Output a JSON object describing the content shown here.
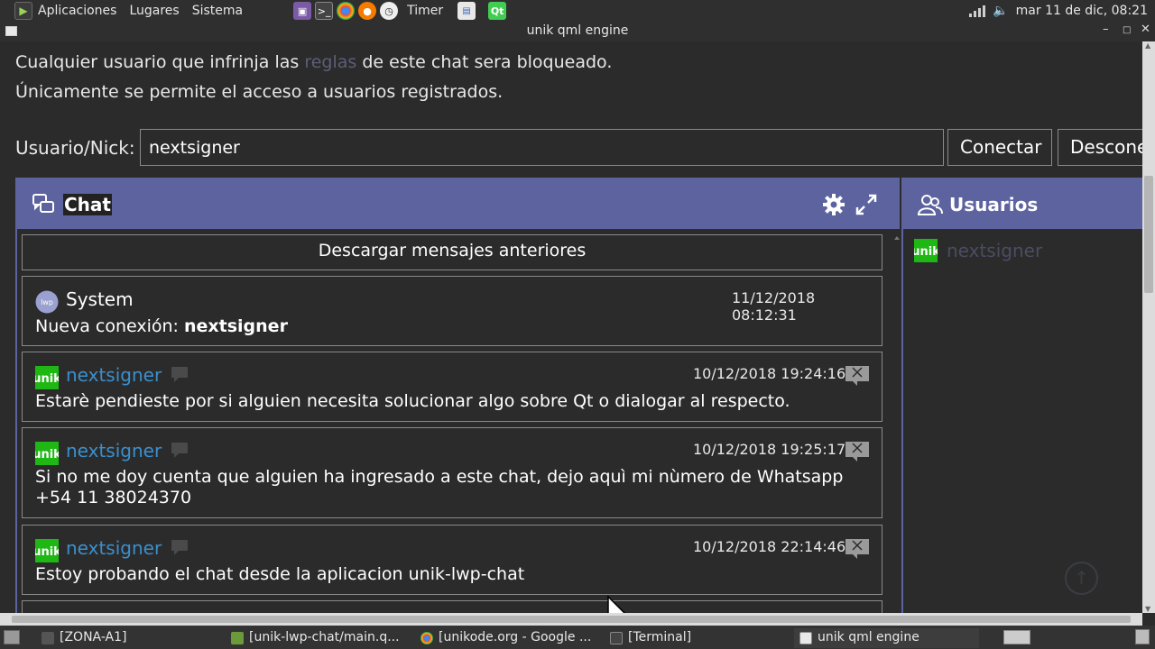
{
  "system_bar": {
    "menu": [
      "Aplicaciones",
      "Lugares",
      "Sistema"
    ],
    "timer_label": "Timer",
    "clock": "mar 11 de dic, 08:21"
  },
  "window": {
    "title": "unik qml engine"
  },
  "notices": {
    "line_rules_before": "Cualquier usuario que infrinja las ",
    "line_rules_link": "reglas",
    "line_rules_after": " de este chat sera bloqueado.",
    "line_registered": "Únicamente se permite el acceso a usuarios registrados."
  },
  "login": {
    "label": "Usuario/Nick:",
    "nick_value": "nextsigner",
    "connect_label": "Conectar",
    "disconnect_label": "Desconectar"
  },
  "chat": {
    "title": "Chat",
    "load_older_label": "Descargar mensajes anteriores",
    "messages": [
      {
        "sender": "System",
        "time": "11/12/2018 08:12:31",
        "text_prefix": "Nueva conexión: ",
        "text_bold": "nextsigner"
      },
      {
        "sender": "nextsigner",
        "time": "10/12/2018 19:24:16",
        "text": "Estarè pendieste por si alguien necesita solucionar algo sobre Qt o dialogar al respecto."
      },
      {
        "sender": "nextsigner",
        "time": "10/12/2018 19:25:17",
        "text": "Si no me doy cuenta que alguien ha ingresado a este chat, dejo aquì mi nùmero de Whatsapp +54 11 38024370"
      },
      {
        "sender": "nextsigner",
        "time": "10/12/2018 22:14:46",
        "text": "Estoy probando el chat desde la aplicacion unik-lwp-chat"
      }
    ]
  },
  "users": {
    "title": "Usuarios",
    "items": [
      "nextsigner"
    ]
  },
  "taskbar": {
    "items": [
      "[ZONA-A1]",
      "[unik-lwp-chat/main.q...",
      "[unikode.org - Google ...",
      "[Terminal]",
      "unik qml engine"
    ]
  },
  "colors": {
    "panel_header": "#5d639f",
    "background": "#2b2b2b",
    "link_user": "#3b8fce",
    "avatar_green": "#1fb714"
  }
}
